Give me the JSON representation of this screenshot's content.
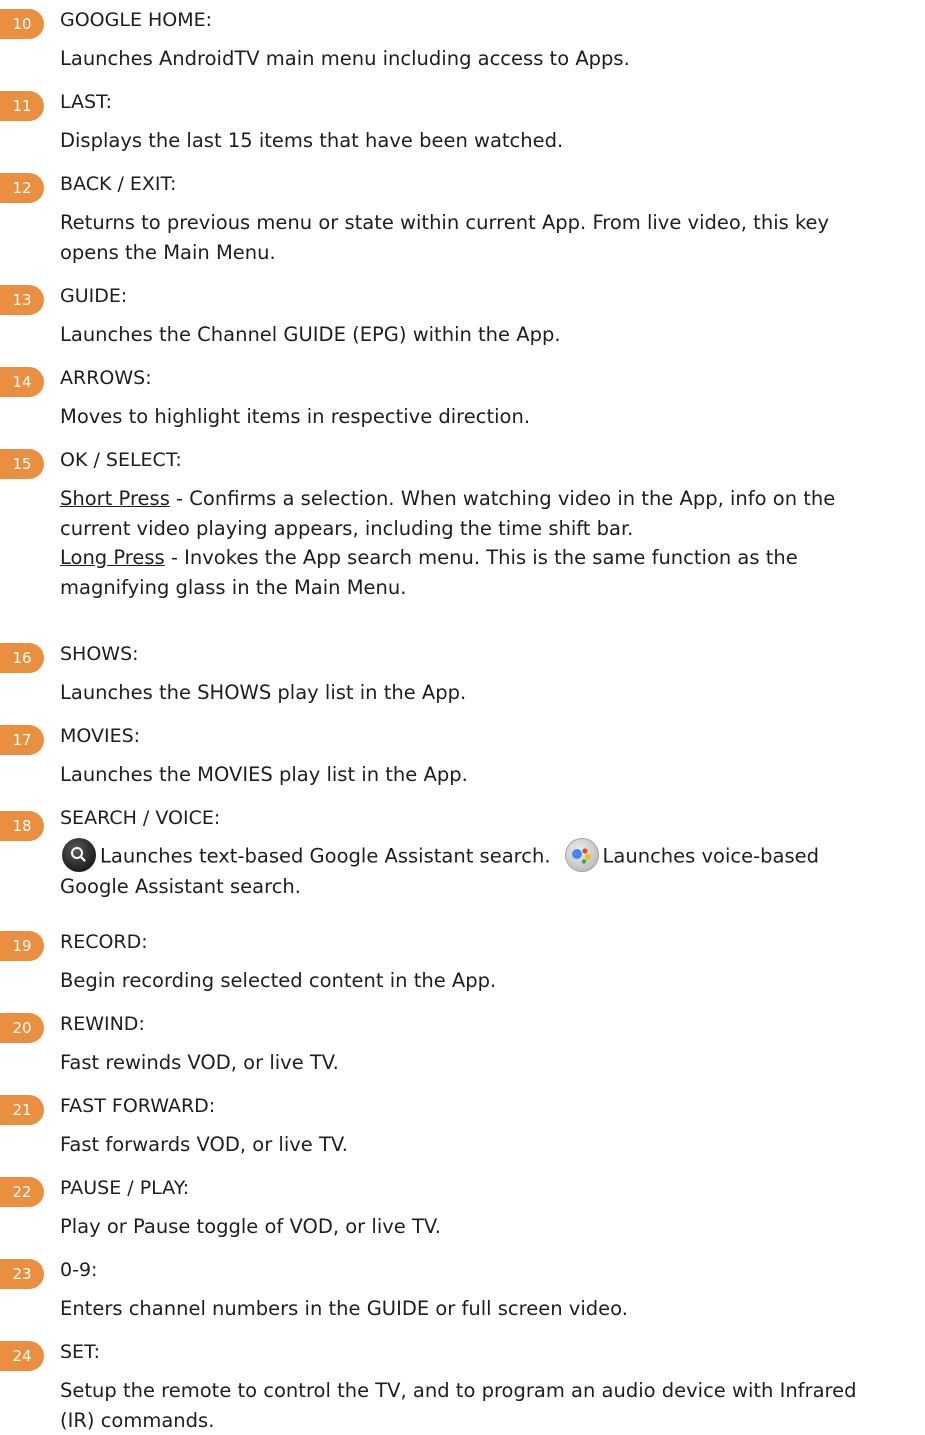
{
  "entries": [
    {
      "num": "10",
      "title": "GOOGLE HOME:",
      "lines": [
        "Launches AndroidTV main menu including access to Apps."
      ]
    },
    {
      "num": "11",
      "title": "LAST:",
      "lines": [
        "Displays the last 15 items that have been watched."
      ]
    },
    {
      "num": "12",
      "title": "BACK / EXIT:",
      "lines": [
        "Returns to previous menu or state within current App. From live video, this key",
        "opens the Main Menu."
      ]
    },
    {
      "num": "13",
      "title": "GUIDE:",
      "lines": [
        "Launches the Channel GUIDE (EPG) within the App."
      ]
    },
    {
      "num": "14",
      "title": "ARROWS:",
      "lines": [
        "Moves to highlight items in respective direction."
      ]
    },
    {
      "num": "15",
      "title": "OK / SELECT:",
      "short_press_label": "Short Press",
      "short_press_lines": [
        " - Confirms a selection. When watching video in the App, info on the",
        "current video playing appears, including the time shift bar."
      ],
      "long_press_label": "Long Press",
      "long_press_lines": [
        " - Invokes the App search menu. This is the same function as the",
        "magnifying glass in the Main Menu."
      ]
    },
    {
      "num": "16",
      "title": "SHOWS:",
      "lines": [
        "Launches the SHOWS play list in the App."
      ]
    },
    {
      "num": "17",
      "title": "MOVIES:",
      "lines": [
        "Launches the MOVIES play list in the App."
      ]
    },
    {
      "num": "18",
      "title": "SEARCH / VOICE:",
      "text_search": "Launches text-based Google Assistant search.",
      "voice_search": "Launches voice-based",
      "voice_search_cont": "Google Assistant search.",
      "icons": [
        "search-icon",
        "google-assistant-icon"
      ]
    },
    {
      "num": "19",
      "title": "RECORD:",
      "lines": [
        "Begin recording selected content in the App."
      ]
    },
    {
      "num": "20",
      "title": "REWIND:",
      "lines": [
        "Fast rewinds VOD, or live TV."
      ]
    },
    {
      "num": "21",
      "title": "FAST FORWARD:",
      "lines": [
        "Fast forwards VOD, or live TV."
      ]
    },
    {
      "num": "22",
      "title": "PAUSE / PLAY:",
      "lines": [
        "Play or Pause toggle of VOD, or live TV."
      ]
    },
    {
      "num": "23",
      "title": "0-9:",
      "lines": [
        "Enters channel numbers in the GUIDE or full screen video."
      ]
    },
    {
      "num": "24",
      "title": "SET:",
      "lines": [
        "Setup the remote to control the TV, and to program an audio device with Infrared",
        "(IR) commands."
      ]
    }
  ],
  "colors": {
    "badge": "#e98f3f",
    "text": "#1e1e1e",
    "background": "#ffffff"
  }
}
